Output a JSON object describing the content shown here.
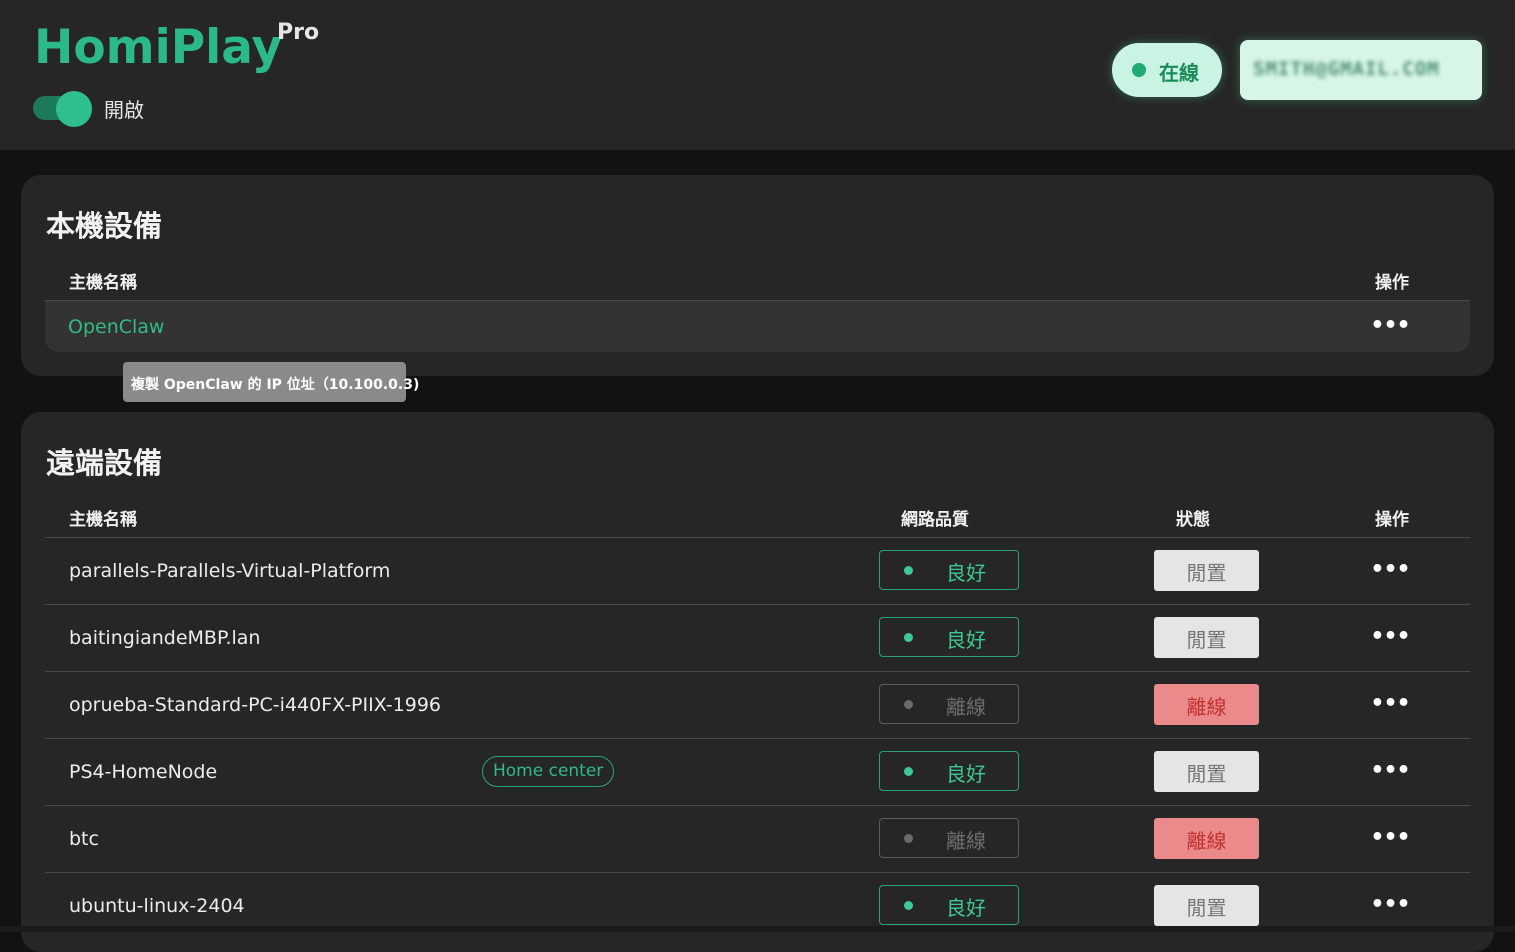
{
  "app": {
    "logo": "HomiPlay",
    "logo_badge": "Pro",
    "toggle_label": "開啟",
    "online_status": "在線",
    "account_email": "SMITH@GMAIL.COM"
  },
  "local": {
    "title": "本機設備",
    "col_host": "主機名稱",
    "col_action": "操作",
    "device_name": "OpenClaw",
    "more": "•••",
    "tooltip": "複製 OpenClaw 的 IP 位址（10.100.0.3)"
  },
  "remote": {
    "title": "遠端設備",
    "col_host": "主機名稱",
    "col_quality": "網路品質",
    "col_status": "狀態",
    "col_action": "操作",
    "rows": [
      {
        "name": "parallels-Parallels-Virtual-Platform",
        "quality": "良好",
        "status": "閒置",
        "more": "•••"
      },
      {
        "name": "baitingiandeMBP.lan",
        "quality": "良好",
        "status": "閒置",
        "more": "•••"
      },
      {
        "name": "oprueba-Standard-PC-i440FX-PIIX-1996",
        "quality": "離線",
        "status": "離線",
        "more": "•••"
      },
      {
        "name": "PS4-HomeNode",
        "tag": "Home center",
        "quality": "良好",
        "status": "閒置",
        "more": "•••"
      },
      {
        "name": "btc",
        "quality": "離線",
        "status": "離線",
        "more": "•••"
      },
      {
        "name": "ubuntu-linux-2404",
        "quality": "良好",
        "status": "閒置",
        "more": "•••"
      }
    ]
  },
  "colors": {
    "brand": "#2bb88a",
    "good": "#3cc995",
    "offline_bg": "#ea8a8a",
    "offline_text": "#c42f2f",
    "idle_bg": "#e5e5e5"
  }
}
